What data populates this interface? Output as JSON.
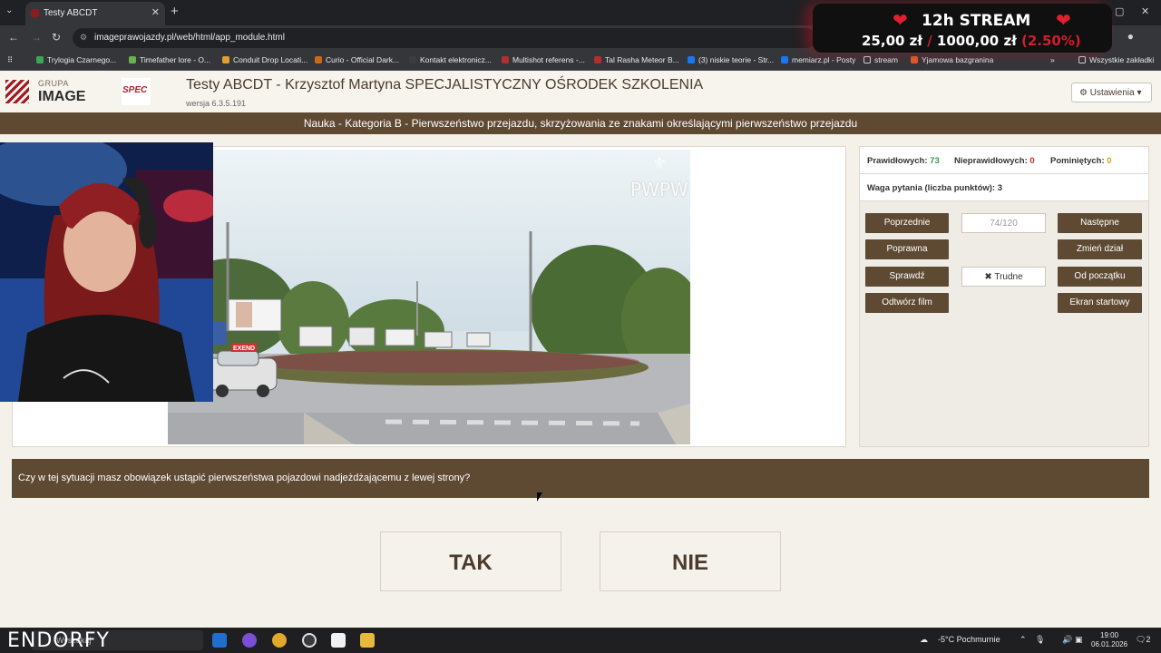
{
  "browser": {
    "tab_title": "Testy ABCDT",
    "url": "imageprawojazdy.pl/web/html/app_module.html",
    "bookmarks": [
      "Trylogia Czarnego...",
      "Timefather lore - O...",
      "Conduit Drop Locati...",
      "Curio - Official Dark...",
      "Kontakt elektronicz...",
      "Multishot referens -...",
      "Tal Rasha Meteor B...",
      "(3) niskie teorie - Str...",
      "memiarz.pl - Posty",
      "stream",
      "Yjamowa bazgranina"
    ],
    "all_bookmarks": "Wszystkie zakładki",
    "new_tab": "+",
    "close_tab": "✕"
  },
  "stream_overlay": {
    "title": "12h STREAM",
    "current": "25,00 zł",
    "separator": "/",
    "goal": "1000,00 zł",
    "percent": "(2.50%)",
    "progress_fraction": 0.025
  },
  "header": {
    "logo_sub": "GRUPA",
    "logo_main": "IMAGE",
    "spec_logo": "SPEC",
    "title": "Testy ABCDT - Krzysztof Martyna SPECJALISTYCZNY OŚRODEK SZKOLENIA",
    "version": "wersja 6.3.5.191",
    "settings_label": "Ustawienia"
  },
  "category_line": "Nauka - Kategoria B - Pierwszeństwo przejazdu, skrzyżowania ze znakami określającymi pierwszeństwo przejazdu",
  "video": {
    "watermark": "PWPW",
    "sign_text": "EXEND"
  },
  "stats": {
    "correct_label": "Prawidłowych:",
    "correct_value": "73",
    "incorrect_label": "Nieprawidłowych:",
    "incorrect_value": "0",
    "skipped_label": "Pominiętych:",
    "skipped_value": "0",
    "weight_label": "Waga pytania (liczba punktów):",
    "weight_value": "3",
    "correct_color": "#2e9c4a",
    "incorrect_color": "#c62828",
    "skipped_color": "#d4a017"
  },
  "controls": {
    "previous": "Poprzednie",
    "counter": "74/120",
    "next": "Następne",
    "correct_answer": "Poprawna",
    "change_section": "Zmień dział",
    "check": "Sprawdź",
    "difficult": "Trudne",
    "from_start": "Od początku",
    "play_film": "Odtwórz film",
    "start_screen": "Ekran startowy"
  },
  "question": "Czy w tej sytuacji masz obowiązek ustąpić pierwszeństwa pojazdowi nadjeżdżającemu z lewej strony?",
  "answers": {
    "yes": "TAK",
    "no": "NIE"
  },
  "taskbar": {
    "brand": "ENDORFY",
    "search_placeholder": "Wyszukaj",
    "weather": "-5°C Pochmurnie",
    "time": "19:00",
    "date": "06.01.2026",
    "notifications": "2"
  },
  "colors": {
    "brand_brown": "#5e4a33",
    "page_bg": "#f4f1ea",
    "accent_red": "#a01a24"
  }
}
